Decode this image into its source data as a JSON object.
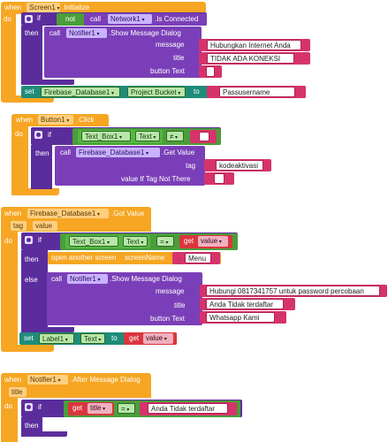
{
  "blocks": {
    "screen_init": {
      "when": "when",
      "component": "Screen1",
      "event": ".Initialize",
      "do": "do",
      "if": "if",
      "not": "not",
      "call": "call",
      "network_component": "Network1",
      "network_prop": ".Is Connected",
      "then": "then",
      "notifier_call": "call",
      "notifier_component": "Notifier1",
      "notifier_method": ".Show Message Dialog",
      "message_label": "message",
      "message_value": "Hubungkan Internet Anda",
      "title_label": "title",
      "title_value": "TIDAK ADA KONEKSI",
      "button_label": "button Text",
      "button_value": "",
      "set": "set",
      "set_component": "Firebase_Database1",
      "set_prop": "Project Bucket",
      "to": "to",
      "set_value": "Passusername"
    },
    "button_click": {
      "when": "when",
      "component": "Button1",
      "event": ".Click",
      "do": "do",
      "if": "if",
      "textbox_component": "Text_Box1",
      "textbox_prop": "Text",
      "op": "≠",
      "compare_value": "",
      "then": "then",
      "call": "call",
      "fb_component": "Firebase_Database1",
      "fb_method": ".Get Value",
      "tag_label": "tag",
      "tag_value": "kodeaktivasi",
      "notag_label": "value If Tag Not There",
      "notag_value": ""
    },
    "got_value": {
      "when": "when",
      "component": "Firebase_Database1",
      "event": ".Got Value",
      "param_tag": "tag",
      "param_value": "value",
      "do": "do",
      "if": "if",
      "textbox_component": "Text_Box1",
      "textbox_prop": "Text",
      "op": "=",
      "get": "get",
      "get_var": "value",
      "then": "then",
      "open_label": "open another screen",
      "screen_label": "screenName",
      "screen_value": "Menu",
      "else": "else",
      "call": "call",
      "notifier_component": "Notifier1",
      "notifier_method": ".Show Message Dialog",
      "message_label": "message",
      "message_value": "Hubungi 0817341757 untuk password percobaan",
      "title_label": "title",
      "title_value": "Anda Tidak terdaftar",
      "button_label": "button Text",
      "button_value": "Whatsapp Kami",
      "set": "set",
      "set_component": "Label1",
      "set_prop": "Text",
      "to": "to",
      "set_get": "get",
      "set_get_var": "value"
    },
    "after_dialog": {
      "when": "when",
      "component": "Notifier1",
      "event": ".After Message Dialog",
      "param": "title",
      "do": "do",
      "if": "if",
      "get": "get",
      "get_var": "title",
      "op": "=",
      "compare_value": "Anda Tidak terdaftar",
      "then": "then"
    }
  }
}
